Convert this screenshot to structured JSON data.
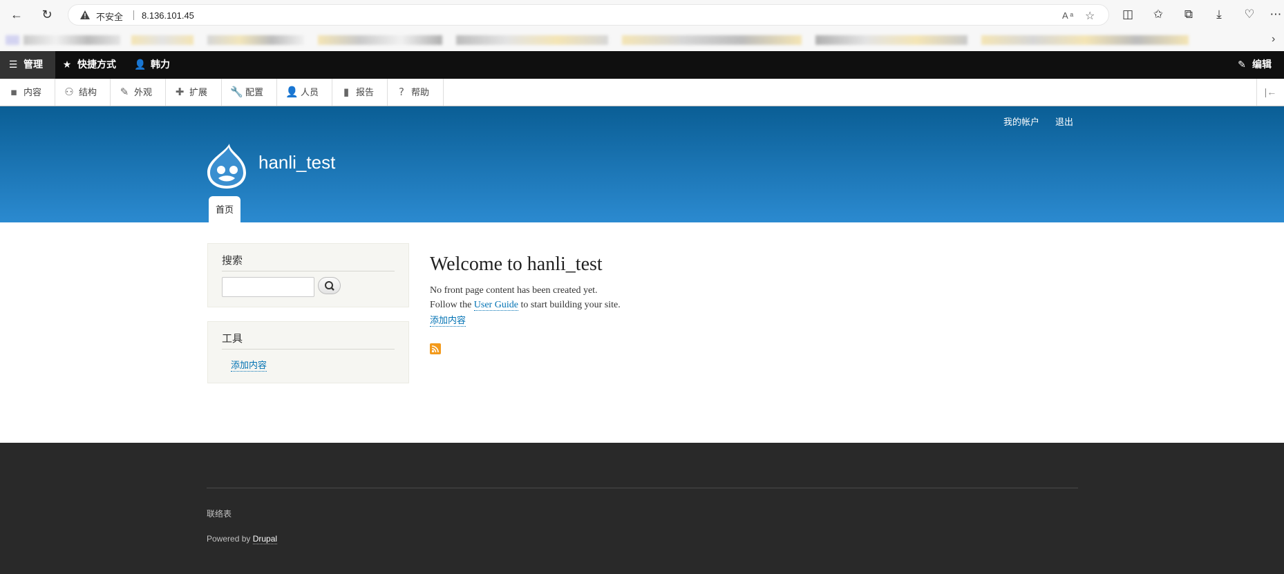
{
  "browser": {
    "back_icon": "←",
    "reload_icon": "↻",
    "insecure_label": "不安全",
    "url": "8.136.101.45",
    "read_aloud_icon": "A ᵃ",
    "favorite_icon": "☆",
    "split_icon": "◫",
    "favorites_icon": "✩",
    "collections_icon": "⧉",
    "download_icon": "⤓",
    "health_icon": "♡",
    "more_icon": "⋯",
    "bookmarks_more_icon": "›"
  },
  "admin_toolbar": {
    "manage": "管理",
    "shortcuts": "快捷方式",
    "user": "韩力",
    "edit": "编辑"
  },
  "admin_tray": [
    {
      "label": "内容",
      "icon": "▪"
    },
    {
      "label": "结构",
      "icon": "⚇"
    },
    {
      "label": "外观",
      "icon": "✎"
    },
    {
      "label": "扩展",
      "icon": "✚"
    },
    {
      "label": "配置",
      "icon": "🔧"
    },
    {
      "label": "人员",
      "icon": "👤"
    },
    {
      "label": "报告",
      "icon": "▮"
    },
    {
      "label": "帮助",
      "icon": "?"
    }
  ],
  "header": {
    "my_account": "我的帐户",
    "logout": "退出",
    "site_name": "hanli_test",
    "home_tab": "首页"
  },
  "sidebar": {
    "search_title": "搜索",
    "search_value": "",
    "tools_title": "工具",
    "tools_link": "添加内容"
  },
  "main": {
    "title": "Welcome to hanli_test",
    "line1": "No front page content has been created yet.",
    "line2_prefix": "Follow the",
    "line2_link": "User Guide",
    "line2_suffix": "to start building your site.",
    "add_content": "添加内容"
  },
  "footer": {
    "contact": "联络表",
    "powered_prefix": "Powered by",
    "powered_link": "Drupal"
  },
  "colors": {
    "header_top": "#0a5e95",
    "header_bottom": "#2b8ad0",
    "link": "#0071b3",
    "footer_bg": "#292929",
    "admin_bar": "#0f0f0f"
  }
}
